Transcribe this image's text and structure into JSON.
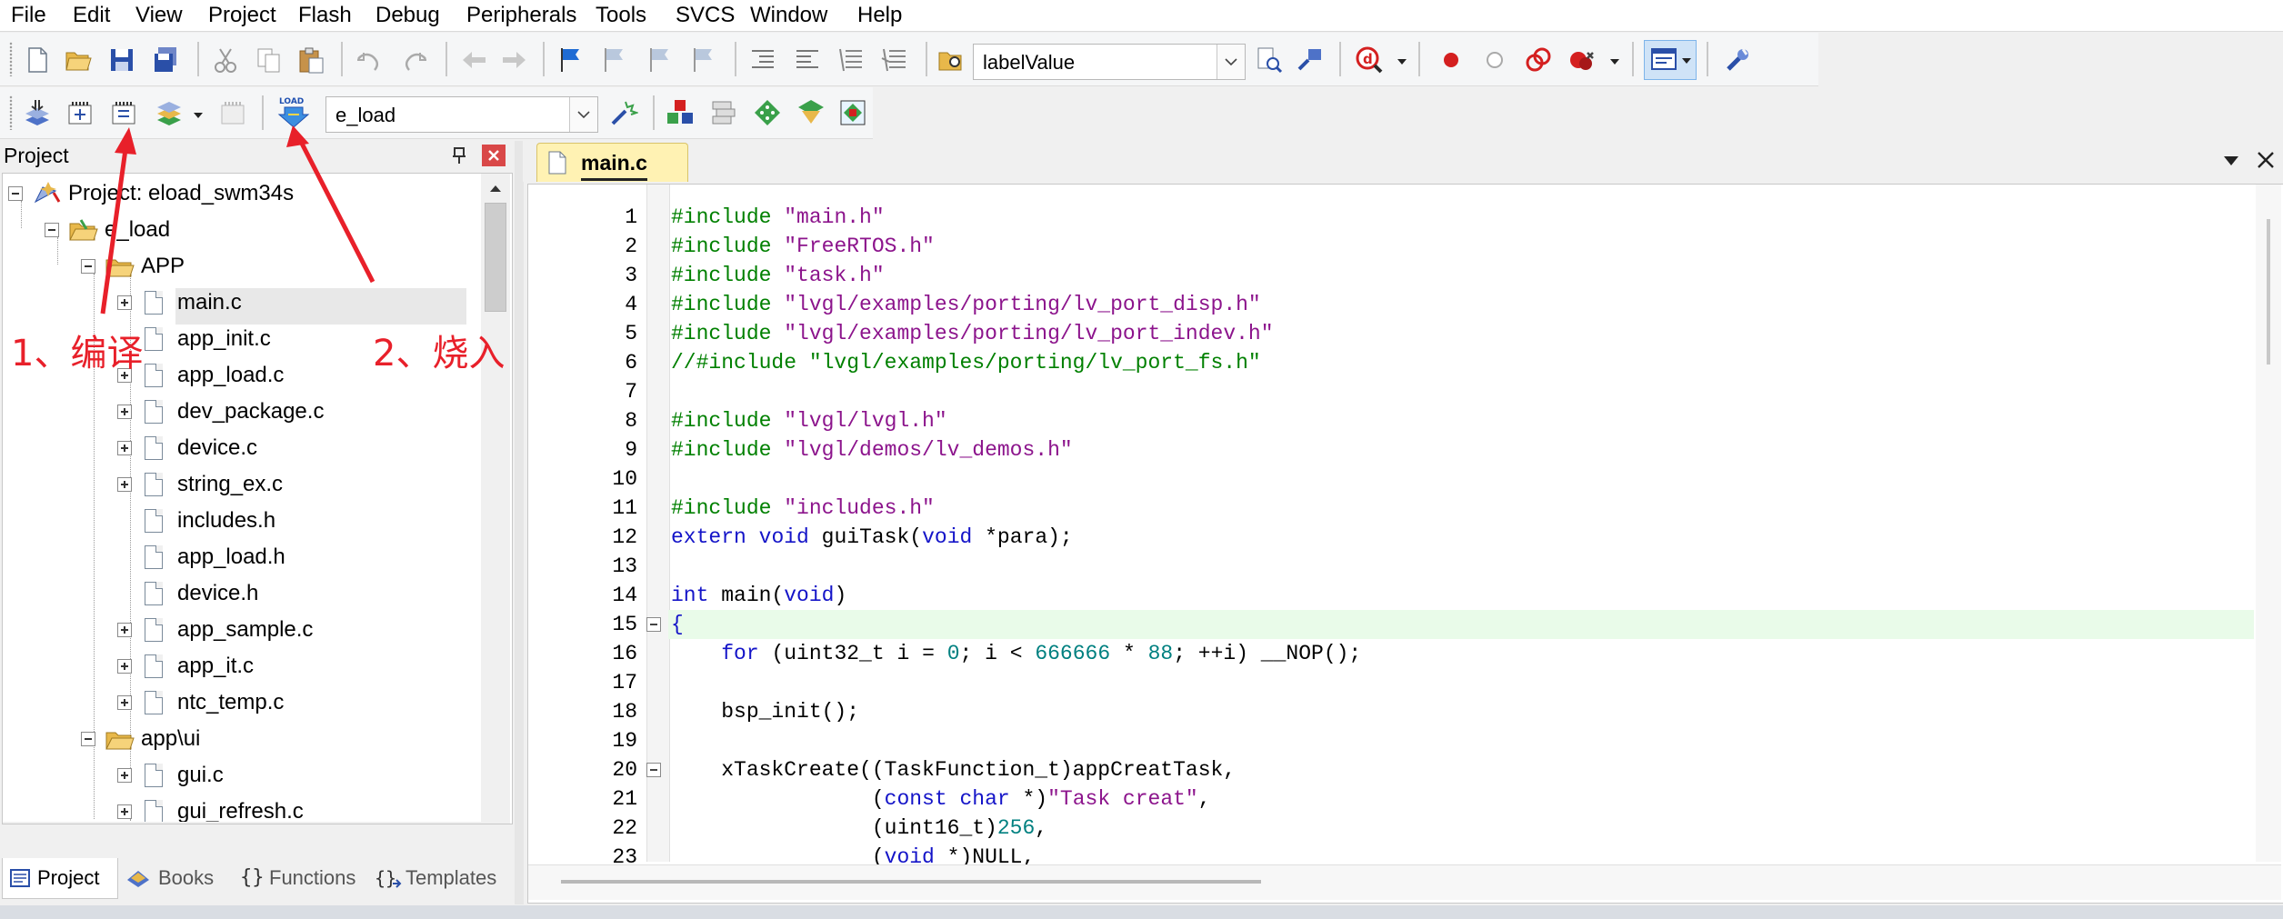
{
  "menu": [
    "File",
    "Edit",
    "View",
    "Project",
    "Flash",
    "Debug",
    "Peripherals",
    "Tools",
    "SVCS",
    "Window",
    "Help"
  ],
  "toolbar": {
    "find_combo_value": "labelValue",
    "target_combo_value": "e_load"
  },
  "project_pane": {
    "title": "Project",
    "pin_icon": "pin-icon",
    "close_icon": "close-icon",
    "tree": [
      {
        "label": "Project: eload_swm34s",
        "level": 0,
        "type": "project",
        "expander": "minus"
      },
      {
        "label": "e_load",
        "level": 1,
        "type": "target",
        "expander": "minus"
      },
      {
        "label": "APP",
        "level": 2,
        "type": "folder",
        "expander": "minus"
      },
      {
        "label": "main.c",
        "level": 3,
        "type": "file",
        "expander": "plus",
        "selected": true
      },
      {
        "label": "app_init.c",
        "level": 3,
        "type": "file",
        "expander": "none"
      },
      {
        "label": "app_load.c",
        "level": 3,
        "type": "file",
        "expander": "plus"
      },
      {
        "label": "dev_package.c",
        "level": 3,
        "type": "file",
        "expander": "plus"
      },
      {
        "label": "device.c",
        "level": 3,
        "type": "file",
        "expander": "plus"
      },
      {
        "label": "string_ex.c",
        "level": 3,
        "type": "file",
        "expander": "plus"
      },
      {
        "label": "includes.h",
        "level": 3,
        "type": "file",
        "expander": "none"
      },
      {
        "label": "app_load.h",
        "level": 3,
        "type": "file",
        "expander": "none"
      },
      {
        "label": "device.h",
        "level": 3,
        "type": "file",
        "expander": "none"
      },
      {
        "label": "app_sample.c",
        "level": 3,
        "type": "file",
        "expander": "plus"
      },
      {
        "label": "app_it.c",
        "level": 3,
        "type": "file",
        "expander": "plus"
      },
      {
        "label": "ntc_temp.c",
        "level": 3,
        "type": "file",
        "expander": "plus"
      },
      {
        "label": "app\\ui",
        "level": 2,
        "type": "folder",
        "expander": "minus"
      },
      {
        "label": "gui.c",
        "level": 3,
        "type": "file",
        "expander": "plus"
      },
      {
        "label": "gui_refresh.c",
        "level": 3,
        "type": "file",
        "expander": "plus"
      }
    ],
    "bottom_tabs": [
      {
        "label": "Project",
        "icon": "project-tab-icon",
        "active": true
      },
      {
        "label": "Books",
        "icon": "books-icon",
        "active": false
      },
      {
        "label": "Functions",
        "icon": "functions-icon",
        "active": false
      },
      {
        "label": "Templates",
        "icon": "templates-icon",
        "active": false
      }
    ]
  },
  "editor": {
    "active_tab": "main.c",
    "lines": [
      {
        "n": "1",
        "t": [
          [
            "pp",
            "#include "
          ],
          [
            "s",
            "\"main.h\""
          ]
        ]
      },
      {
        "n": "2",
        "t": [
          [
            "pp",
            "#include "
          ],
          [
            "s",
            "\"FreeRTOS.h\""
          ]
        ]
      },
      {
        "n": "3",
        "t": [
          [
            "pp",
            "#include "
          ],
          [
            "s",
            "\"task.h\""
          ]
        ]
      },
      {
        "n": "4",
        "t": [
          [
            "pp",
            "#include "
          ],
          [
            "s",
            "\"lvgl/examples/porting/lv_port_disp.h\""
          ]
        ]
      },
      {
        "n": "5",
        "t": [
          [
            "pp",
            "#include "
          ],
          [
            "s",
            "\"lvgl/examples/porting/lv_port_indev.h\""
          ]
        ]
      },
      {
        "n": "6",
        "t": [
          [
            "c",
            "//#include \"lvgl/examples/porting/lv_port_fs.h\""
          ]
        ]
      },
      {
        "n": "7",
        "t": []
      },
      {
        "n": "8",
        "t": [
          [
            "pp",
            "#include "
          ],
          [
            "s",
            "\"lvgl/lvgl.h\""
          ]
        ]
      },
      {
        "n": "9",
        "t": [
          [
            "pp",
            "#include "
          ],
          [
            "s",
            "\"lvgl/demos/lv_demos.h\""
          ]
        ]
      },
      {
        "n": "10",
        "t": []
      },
      {
        "n": "11",
        "t": [
          [
            "pp",
            "#include "
          ],
          [
            "s",
            "\"includes.h\""
          ]
        ]
      },
      {
        "n": "12",
        "t": [
          [
            "k",
            "extern"
          ],
          [
            "p",
            " "
          ],
          [
            "k",
            "void"
          ],
          [
            "p",
            " guiTask("
          ],
          [
            "k",
            "void"
          ],
          [
            "p",
            " *para);"
          ]
        ]
      },
      {
        "n": "13",
        "t": []
      },
      {
        "n": "14",
        "t": [
          [
            "k",
            "int"
          ],
          [
            "p",
            " main("
          ],
          [
            "k",
            "void"
          ],
          [
            "p",
            ")"
          ]
        ]
      },
      {
        "n": "15",
        "t": [
          [
            "k",
            "{"
          ]
        ],
        "fold": true,
        "highlight": true
      },
      {
        "n": "16",
        "t": [
          [
            "p",
            "    "
          ],
          [
            "k",
            "for"
          ],
          [
            "p",
            " (uint32_t i = "
          ],
          [
            "n",
            "0"
          ],
          [
            "p",
            "; i < "
          ],
          [
            "n",
            "666666"
          ],
          [
            "p",
            " * "
          ],
          [
            "n",
            "88"
          ],
          [
            "p",
            "; ++i) __NOP();"
          ]
        ]
      },
      {
        "n": "17",
        "t": []
      },
      {
        "n": "18",
        "t": [
          [
            "p",
            "    bsp_init();"
          ]
        ]
      },
      {
        "n": "19",
        "t": []
      },
      {
        "n": "20",
        "t": [
          [
            "p",
            "    xTaskCreate((TaskFunction_t)appCreatTask,"
          ]
        ],
        "fold": true
      },
      {
        "n": "21",
        "t": [
          [
            "p",
            "                ("
          ],
          [
            "k",
            "const"
          ],
          [
            "p",
            " "
          ],
          [
            "k",
            "char"
          ],
          [
            "p",
            " *)"
          ],
          [
            "s",
            "\"Task creat\""
          ],
          [
            "p",
            ","
          ]
        ]
      },
      {
        "n": "22",
        "t": [
          [
            "p",
            "                (uint16_t)"
          ],
          [
            "n",
            "256"
          ],
          [
            "p",
            ","
          ]
        ]
      },
      {
        "n": "23",
        "t": [
          [
            "p",
            "                ("
          ],
          [
            "k",
            "void"
          ],
          [
            "p",
            " *)NULL,"
          ]
        ]
      }
    ]
  },
  "annotations": {
    "compile": "1、编译",
    "download": "2、烧入"
  },
  "colors": {
    "annotation": "#e8202a",
    "keyword": "#1414c8",
    "string": "#8c148c",
    "preprocessor": "#008000",
    "number": "#008080",
    "highlight_line": "#e9fbe9",
    "active_tab": "#fff2b3"
  }
}
